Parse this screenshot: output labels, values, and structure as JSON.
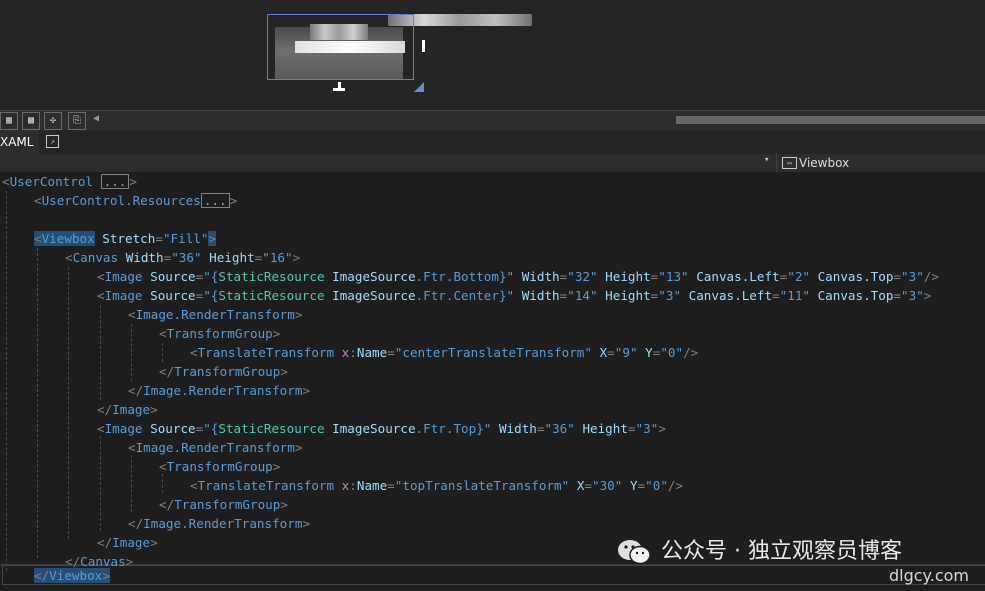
{
  "tabs": {
    "xaml": "XAML"
  },
  "navbar": {
    "element": "Viewbox"
  },
  "code": {
    "l0": {
      "tag": "UserControl",
      "fold": "..."
    },
    "l1": {
      "tag": "UserControl.Resources",
      "fold": "..."
    },
    "l2": {
      "tag": "Viewbox",
      "attr": "Stretch",
      "val": "Fill"
    },
    "l3": {
      "tag": "Canvas",
      "a1": "Width",
      "v1": "36",
      "a2": "Height",
      "v2": "16"
    },
    "l4": {
      "tag": "Image",
      "a1": "Source",
      "sr": "StaticResource",
      "src": "ImageSource",
      "rest": ".Ftr.Bottom",
      "a2": "Width",
      "v2": "32",
      "a3": "Height",
      "v3": "13",
      "a4": "Canvas.Left",
      "v4": "2",
      "a5": "Canvas.Top",
      "v5": "3"
    },
    "l5": {
      "tag": "Image",
      "a1": "Source",
      "sr": "StaticResource",
      "src": "ImageSource",
      "rest": ".Ftr.Center",
      "a2": "Width",
      "v2": "14",
      "a3": "Height",
      "v3": "3",
      "a4": "Canvas.Left",
      "v4": "11",
      "a5": "Canvas.Top",
      "v5": "3"
    },
    "l6": {
      "tag": "Image.RenderTransform"
    },
    "l7": {
      "tag": "TransformGroup"
    },
    "l8": {
      "tag": "TranslateTransform",
      "px": "x",
      "nm": "Name",
      "val": "centerTranslateTransform",
      "a2": "X",
      "v2": "9",
      "a3": "Y",
      "v3": "0"
    },
    "l9": {
      "tag": "TransformGroup"
    },
    "l10": {
      "tag": "Image.RenderTransform"
    },
    "l11": {
      "tag": "Image"
    },
    "l12": {
      "tag": "Image",
      "a1": "Source",
      "sr": "StaticResource",
      "src": "ImageSource",
      "rest": ".Ftr.Top",
      "a2": "Width",
      "v2": "36",
      "a3": "Height",
      "v3": "3"
    },
    "l13": {
      "tag": "Image.RenderTransform"
    },
    "l14": {
      "tag": "TransformGroup"
    },
    "l15": {
      "tag": "TranslateTransform",
      "px": "x",
      "nm": "Name",
      "val": "topTranslateTransform",
      "a2": "X",
      "v2": "30",
      "a3": "Y",
      "v3": "0"
    },
    "l16": {
      "tag": "TransformGroup"
    },
    "l17": {
      "tag": "Image.RenderTransform"
    },
    "l18": {
      "tag": "Image"
    },
    "l19": {
      "tag": "Canvas"
    },
    "l20": {
      "tag": "Viewbox"
    }
  },
  "watermark": {
    "text": "公众号 · 独立观察员博客",
    "site": "dlgcy.com"
  }
}
